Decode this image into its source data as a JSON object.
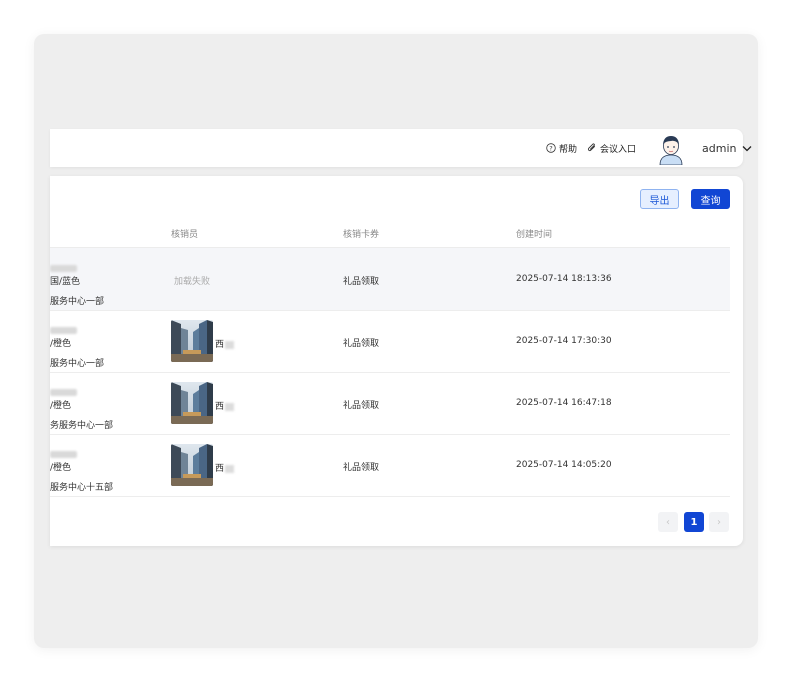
{
  "header": {
    "help_label": "帮助",
    "meeting_label": "会议入口",
    "username": "admin",
    "icons": {
      "help": "question-circle-icon",
      "meeting": "paperclip-icon",
      "dropdown": "chevron-down-icon"
    }
  },
  "toolbar": {
    "export_label": "导出",
    "query_label": "查询"
  },
  "table": {
    "columns": [
      "核销员",
      "核销卡券",
      "创建时间"
    ],
    "rows": [
      {
        "line1": "国/蓝色",
        "line2": "服务中心一部",
        "verifier_status": "加载失败",
        "verifier_name": "",
        "coupon": "礼品领取",
        "time": "2025-07-14 18:13:36"
      },
      {
        "line1": "/橙色",
        "line2": "服务中心一部",
        "verifier_status": "",
        "verifier_name": "西",
        "coupon": "礼品领取",
        "time": "2025-07-14 17:30:30"
      },
      {
        "line1": "/橙色",
        "line2": "务服务中心一部",
        "verifier_status": "",
        "verifier_name": "西",
        "coupon": "礼品领取",
        "time": "2025-07-14 16:47:18"
      },
      {
        "line1": "/橙色",
        "line2": "服务中心十五部",
        "verifier_status": "",
        "verifier_name": "西",
        "coupon": "礼品领取",
        "time": "2025-07-14 14:05:20"
      }
    ]
  },
  "pagination": {
    "prev": "‹",
    "current": "1",
    "next": "›"
  },
  "colors": {
    "primary": "#1146d4",
    "export_bg": "#e6efff",
    "frame_bg": "#eeeeee"
  }
}
